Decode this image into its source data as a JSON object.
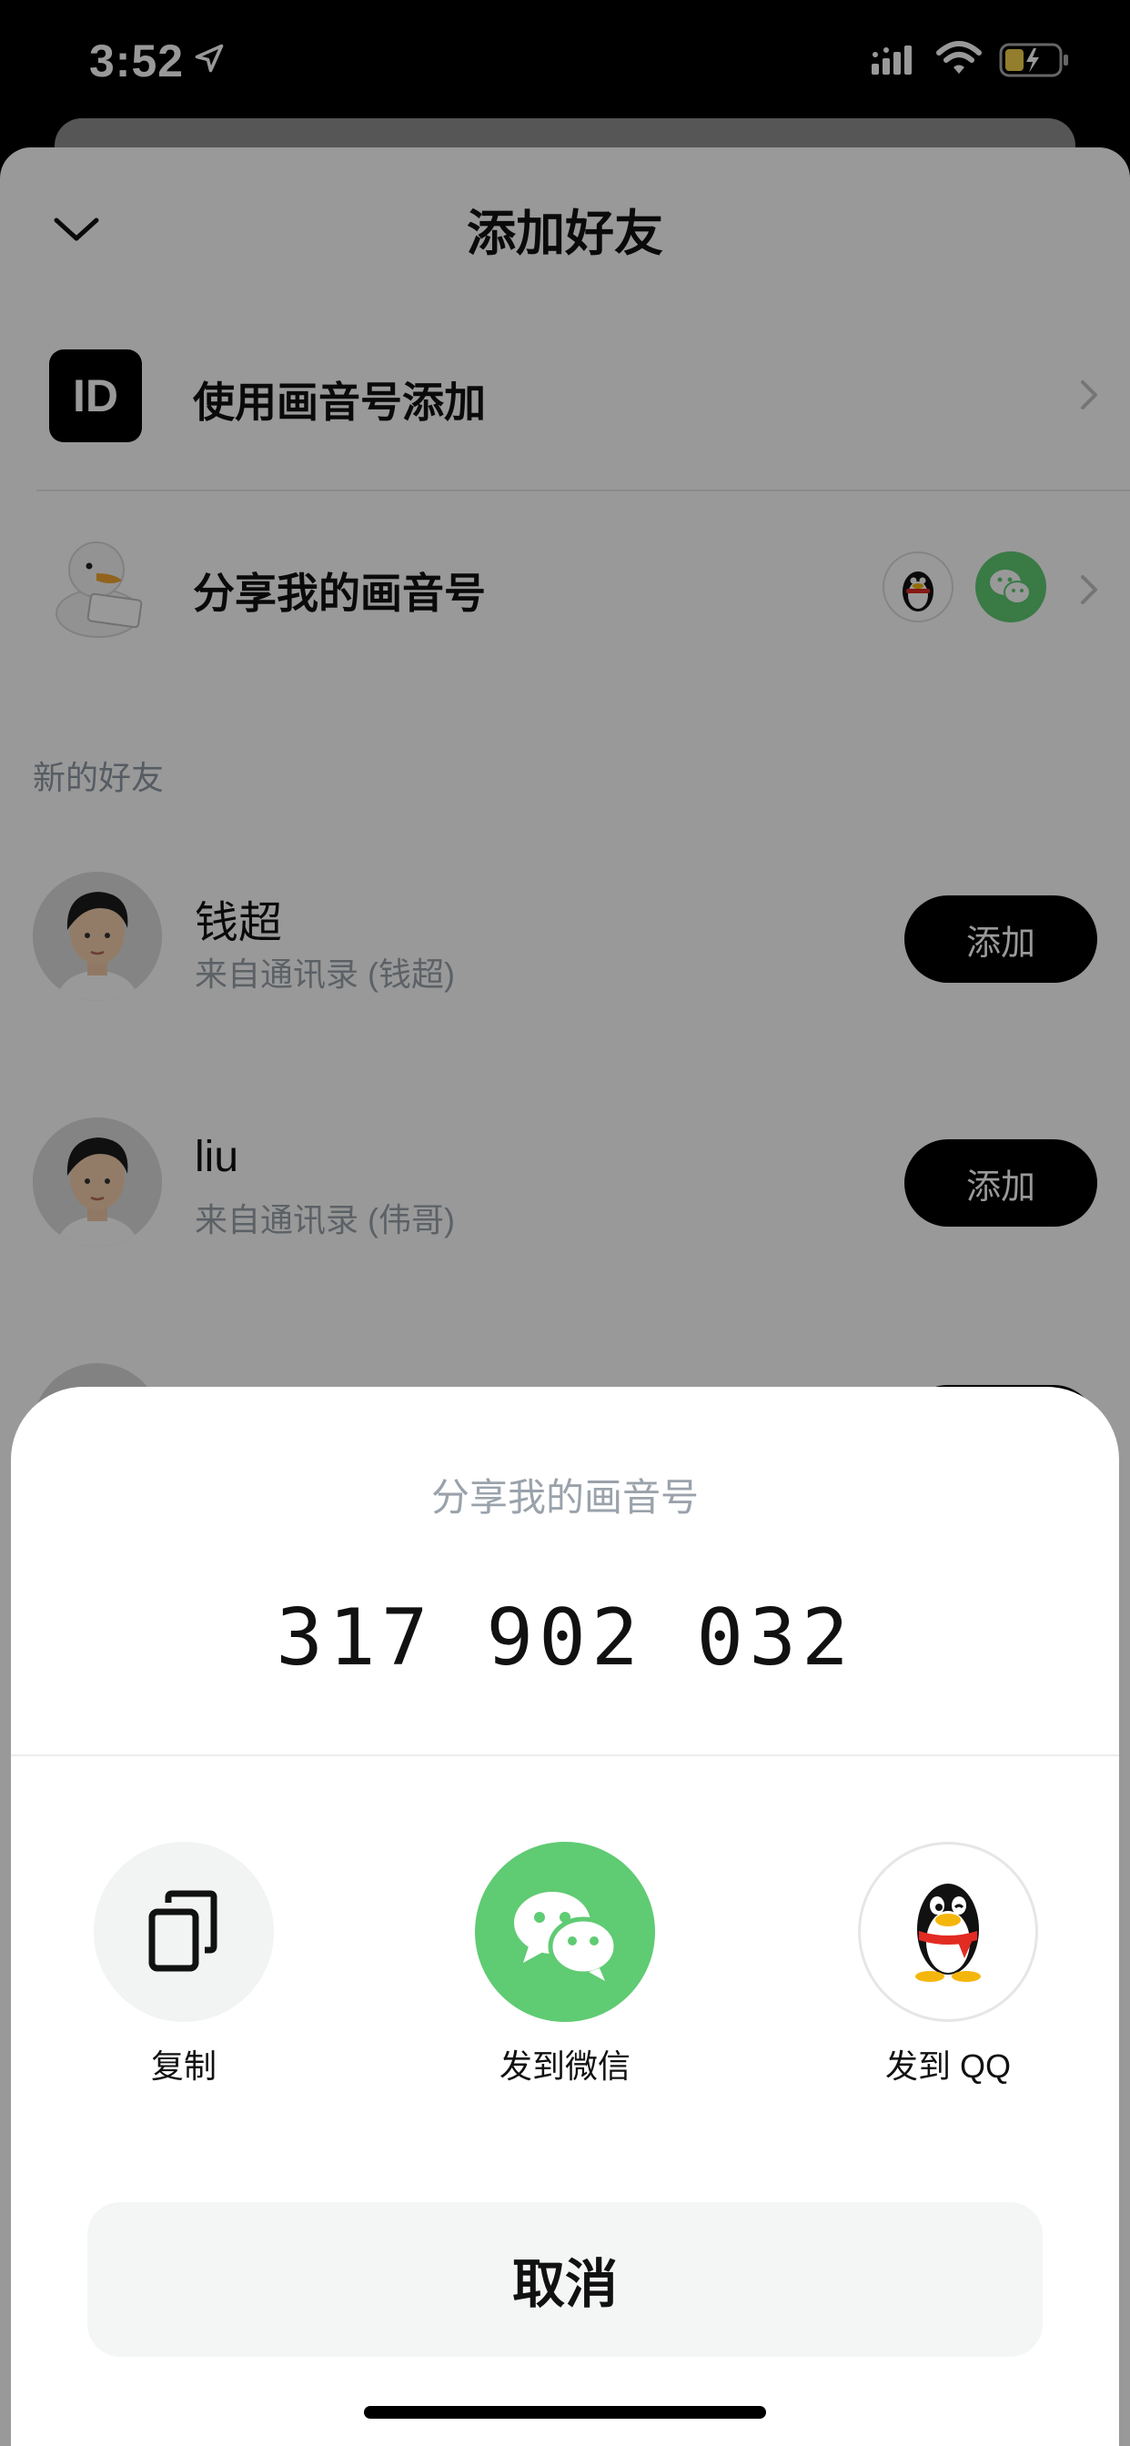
{
  "status_bar": {
    "time": "3:52"
  },
  "header": {
    "title": "添加好友"
  },
  "menu": {
    "id_badge": "ID",
    "use_id_label": "使用画音号添加",
    "share_label": "分享我的画音号"
  },
  "new_friends": {
    "section_label": "新的好友",
    "items": [
      {
        "name": "钱超",
        "subtitle": "来自通讯录 (钱超)",
        "button": "添加"
      },
      {
        "name": "liu",
        "subtitle": "来自通讯录 (伟哥)",
        "button": "添加"
      }
    ]
  },
  "share_modal": {
    "title": "分享我的画音号",
    "id_number": "317 902 032",
    "actions": [
      {
        "label": "复制",
        "icon": "copy-icon"
      },
      {
        "label": "发到微信",
        "icon": "wechat-icon"
      },
      {
        "label": "发到 QQ",
        "icon": "qq-icon"
      }
    ],
    "cancel_label": "取消"
  },
  "colors": {
    "wechat_green": "#5fcb73",
    "overlay": "rgba(0,0,0,0.40)"
  }
}
